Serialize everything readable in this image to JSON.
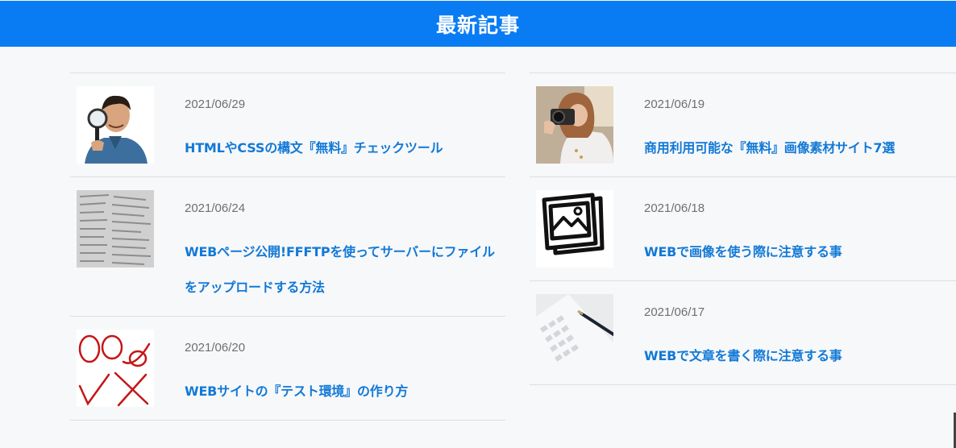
{
  "header": {
    "title": "最新記事"
  },
  "articles_left": [
    {
      "date": "2021/06/29",
      "title": "HTMLやCSSの構文『無料』チェックツール",
      "icon": "man-magnifier-photo"
    },
    {
      "date": "2021/06/24",
      "title": "WEBページ公開!FFFTPを使ってサーバーにファイルをアップロードする方法",
      "icon": "file-list-photo"
    },
    {
      "date": "2021/06/20",
      "title": "WEBサイトの『テスト環境』の作り方",
      "icon": "red-check-marks"
    }
  ],
  "articles_right": [
    {
      "date": "2021/06/19",
      "title": "商用利用可能な『無料』画像素材サイト7選",
      "icon": "camera-woman-photo"
    },
    {
      "date": "2021/06/18",
      "title": "WEBで画像を使う際に注意する事",
      "icon": "image-frames-icon"
    },
    {
      "date": "2021/06/17",
      "title": "WEBで文章を書く際に注意する事",
      "icon": "keyboard-pen-photo"
    }
  ],
  "colors": {
    "header": "#0a7cf3",
    "link": "#1279d6",
    "date": "#6f6f6f",
    "background": "#f7f8fa"
  }
}
